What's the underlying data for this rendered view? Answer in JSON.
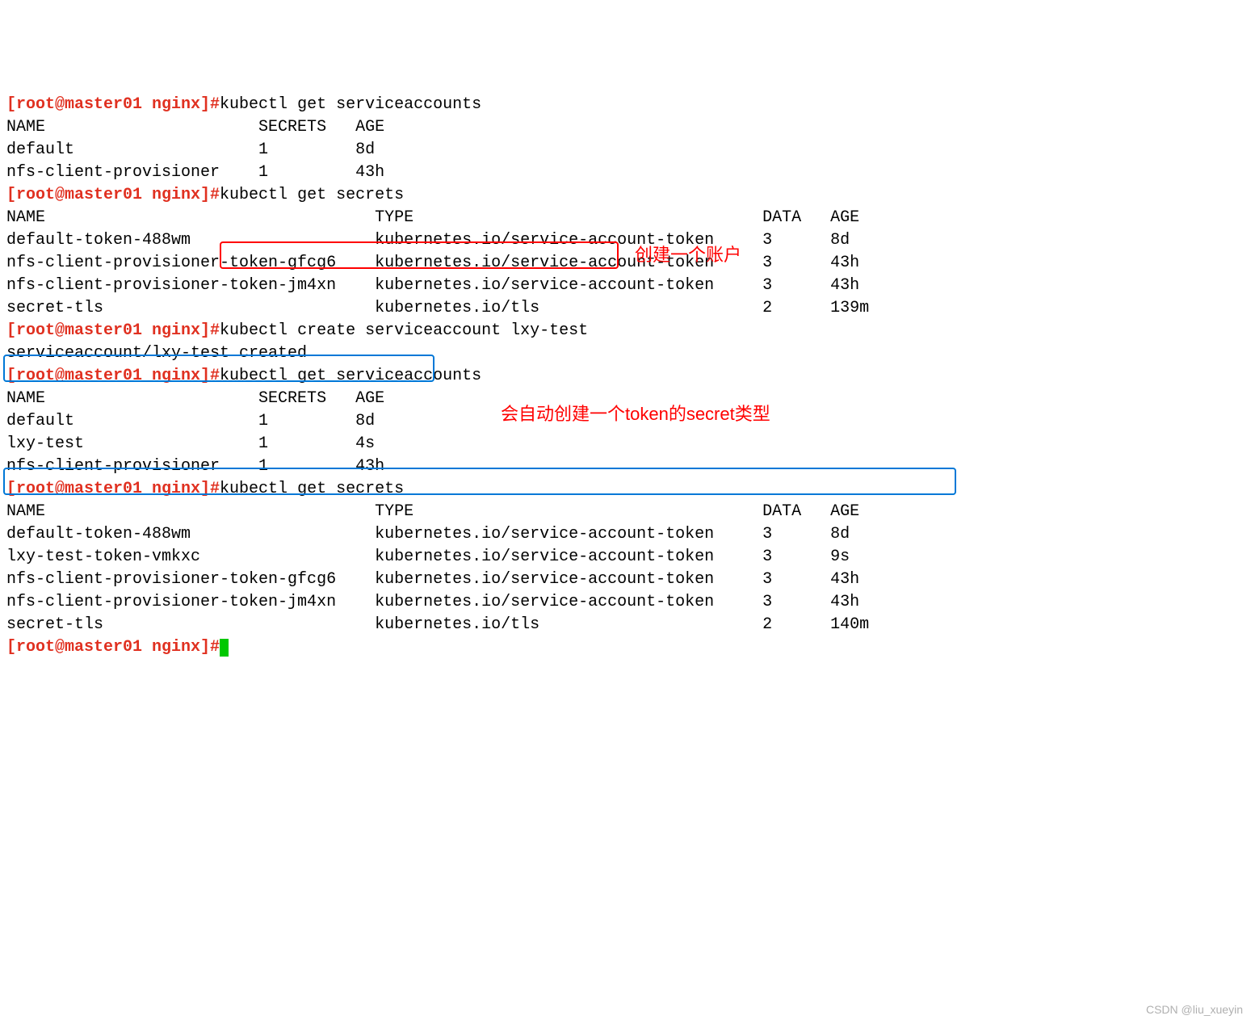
{
  "prompt": "[root@master01 nginx]#",
  "cmds": {
    "get_sa1": "kubectl get serviceaccounts",
    "get_secrets1": "kubectl get secrets",
    "create_sa": "kubectl create serviceaccount lxy-test",
    "get_sa2": "kubectl get serviceaccounts",
    "get_secrets2": "kubectl get secrets"
  },
  "sa_header": {
    "name": "NAME",
    "secrets": "SECRETS",
    "age": "AGE"
  },
  "sa_list1": [
    {
      "name": "default",
      "secrets": "1",
      "age": "8d"
    },
    {
      "name": "nfs-client-provisioner",
      "secrets": "1",
      "age": "43h"
    }
  ],
  "secrets_header": {
    "name": "NAME",
    "type": "TYPE",
    "data": "DATA",
    "age": "AGE"
  },
  "secrets_list1": [
    {
      "name": "default-token-488wm",
      "type": "kubernetes.io/service-account-token",
      "data": "3",
      "age": "8d"
    },
    {
      "name": "nfs-client-provisioner-token-gfcg6",
      "type": "kubernetes.io/service-account-token",
      "data": "3",
      "age": "43h"
    },
    {
      "name": "nfs-client-provisioner-token-jm4xn",
      "type": "kubernetes.io/service-account-token",
      "data": "3",
      "age": "43h"
    },
    {
      "name": "secret-tls",
      "type": "kubernetes.io/tls",
      "data": "2",
      "age": "139m"
    }
  ],
  "create_output": "serviceaccount/lxy-test created",
  "sa_list2": [
    {
      "name": "default",
      "secrets": "1",
      "age": "8d"
    },
    {
      "name": "lxy-test",
      "secrets": "1",
      "age": "4s"
    },
    {
      "name": "nfs-client-provisioner",
      "secrets": "1",
      "age": "43h"
    }
  ],
  "secrets_list2": [
    {
      "name": "default-token-488wm",
      "type": "kubernetes.io/service-account-token",
      "data": "3",
      "age": "8d"
    },
    {
      "name": "lxy-test-token-vmkxc",
      "type": "kubernetes.io/service-account-token",
      "data": "3",
      "age": "9s"
    },
    {
      "name": "nfs-client-provisioner-token-gfcg6",
      "type": "kubernetes.io/service-account-token",
      "data": "3",
      "age": "43h"
    },
    {
      "name": "nfs-client-provisioner-token-jm4xn",
      "type": "kubernetes.io/service-account-token",
      "data": "3",
      "age": "43h"
    },
    {
      "name": "secret-tls",
      "type": "kubernetes.io/tls",
      "data": "2",
      "age": "140m"
    }
  ],
  "annotations": {
    "a1": "创建一个账户",
    "a2": "会自动创建一个token的secret类型"
  },
  "watermark": "CSDN @liu_xueyin"
}
